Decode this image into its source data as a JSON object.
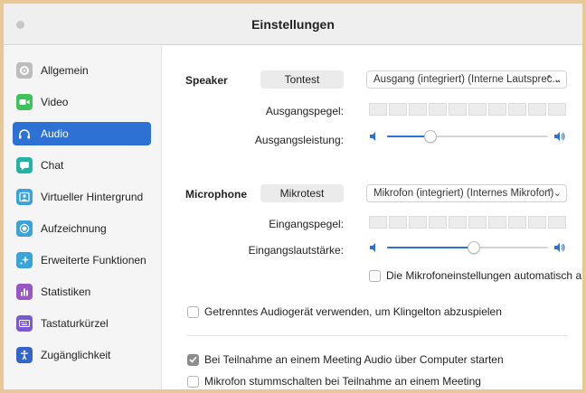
{
  "window": {
    "title": "Einstellungen"
  },
  "sidebar": {
    "items": [
      {
        "label": "Allgemein",
        "icon": "gear-icon",
        "color": "#bdbdbd"
      },
      {
        "label": "Video",
        "icon": "video-camera-icon",
        "color": "#3fc25c"
      },
      {
        "label": "Audio",
        "icon": "headphones-icon",
        "color": "#2e71d4",
        "active": true
      },
      {
        "label": "Chat",
        "icon": "chat-bubble-icon",
        "color": "#22b3a5"
      },
      {
        "label": "Virtueller Hintergrund",
        "icon": "person-frame-icon",
        "color": "#3aa3d8"
      },
      {
        "label": "Aufzeichnung",
        "icon": "record-icon",
        "color": "#3aa3d8"
      },
      {
        "label": "Erweiterte Funktionen",
        "icon": "sparkle-icon",
        "color": "#3aa3d8"
      },
      {
        "label": "Statistiken",
        "icon": "bar-chart-icon",
        "color": "#9a55c5"
      },
      {
        "label": "Tastaturkürzel",
        "icon": "keyboard-icon",
        "color": "#7b5ad0"
      },
      {
        "label": "Zugänglichkeit",
        "icon": "accessibility-icon",
        "color": "#3564c9"
      }
    ]
  },
  "speaker": {
    "label": "Speaker",
    "test_button": "Tontest",
    "device": "Ausgang (integriert) (Interne Lautsprec...",
    "output_level_label": "Ausgangspegel:",
    "output_volume_label": "Ausgangsleistung:",
    "output_volume": 0.27
  },
  "microphone": {
    "label": "Microphone",
    "test_button": "Mikrotest",
    "device": "Mikrofon (integriert) (Internes Mikrofon)",
    "input_level_label": "Eingangspegel:",
    "input_volume_label": "Eingangslautstärke:",
    "input_volume": 0.54,
    "auto_adjust_label": "Die Mikrofoneinstellungen automatisch anpassen",
    "auto_adjust_checked": false
  },
  "options": {
    "separate_device_label": "Getrenntes Audiogerät verwenden, um Klingelton abzuspielen",
    "separate_device_checked": false,
    "join_audio_label": "Bei Teilnahme an einem Meeting Audio über Computer starten",
    "join_audio_checked": true,
    "mute_on_join_label": "Mikrofon stummschalten bei Teilnahme an einem Meeting",
    "mute_on_join_checked": false
  },
  "colors": {
    "accent": "#2e71d4",
    "frame": "#e7c896"
  }
}
